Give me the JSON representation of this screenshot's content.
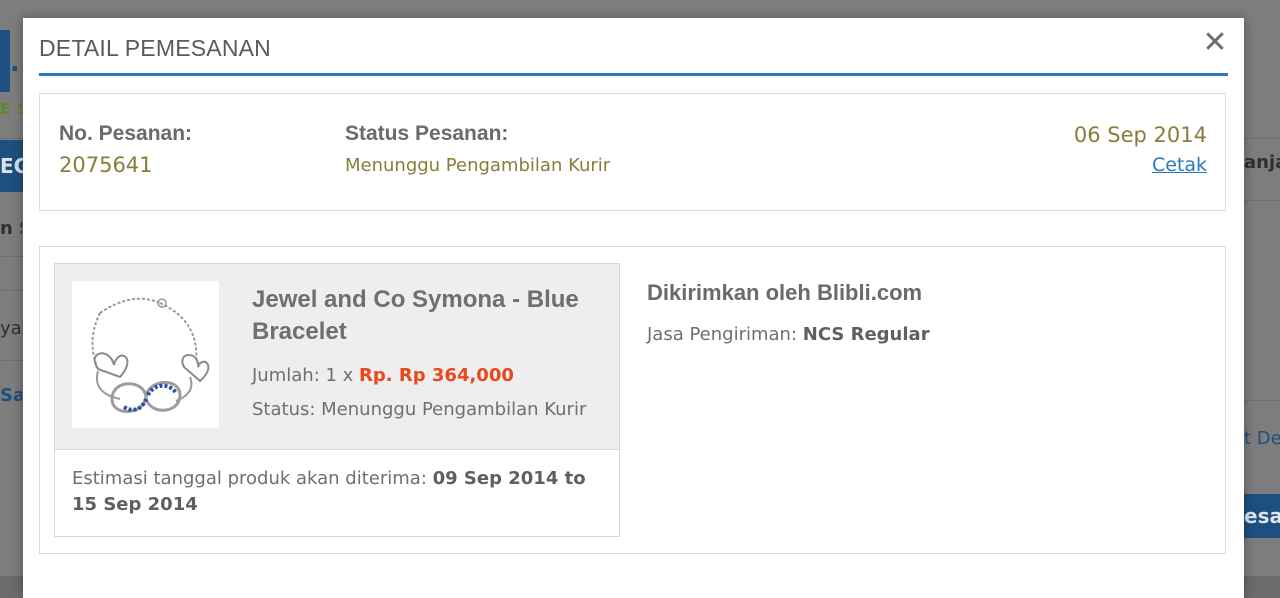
{
  "background": {
    "left_fragments": [
      "EG",
      "n S",
      "ya",
      "Say"
    ],
    "right_fragments": [
      "anja",
      "t De",
      "esar"
    ]
  },
  "modal": {
    "title": "DETAIL PEMESANAN",
    "close_symbol": "✕"
  },
  "order": {
    "number_label": "No. Pesanan:",
    "number_value": "2075641",
    "status_label": "Status Pesanan:",
    "status_value": "Menunggu Pengambilan Kurir",
    "date": "06 Sep 2014",
    "print_link": "Cetak"
  },
  "product": {
    "name": "Jewel and Co Symona - Blue Bracelet",
    "quantity_label": "Jumlah: 1 x ",
    "price": "Rp. Rp 364,000",
    "status_label": "Status: ",
    "status_value": "Menunggu Pengambilan Kurir",
    "estimate_label": "Estimasi tanggal produk akan diterima: ",
    "estimate_value": "09 Sep 2014 to 15 Sep 2014"
  },
  "shipping": {
    "title": "Dikirimkan oleh Blibli.com",
    "courier_label": "Jasa Pengiriman: ",
    "courier_value": "NCS Regular"
  },
  "colors": {
    "accent_blue": "#2a79bd",
    "order_value_olive": "#877e3a",
    "price_orange": "#e8481b"
  }
}
